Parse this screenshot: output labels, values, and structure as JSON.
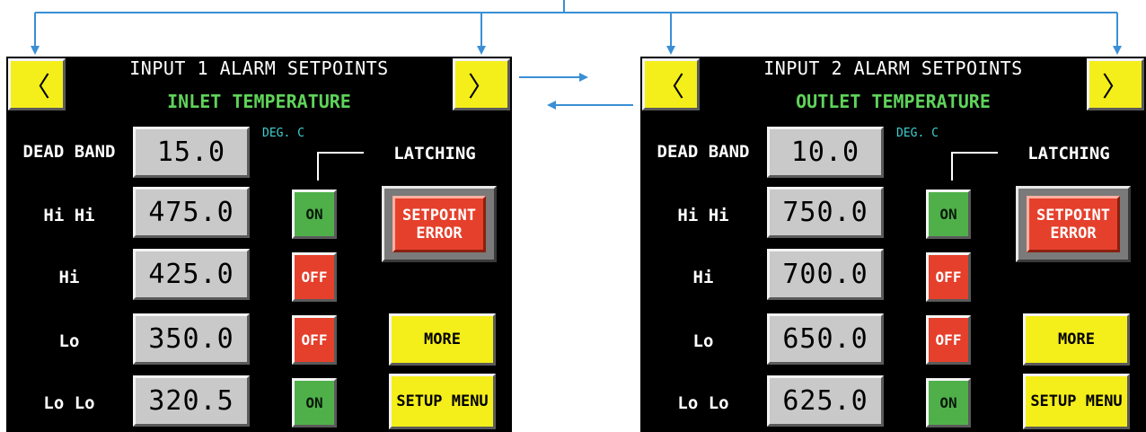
{
  "connector_color": "#3a8fd6",
  "screens": [
    {
      "title": "INPUT 1 ALARM SETPOINTS",
      "subtitle": "INLET TEMPERATURE",
      "prev_label": "〈",
      "next_label": "〉",
      "unit": "DEG. C",
      "latching_label": "LATCHING",
      "error_label": "SETPOINT ERROR",
      "more_label": "MORE",
      "setup_label": "SETUP MENU",
      "deadband": {
        "label": "DEAD BAND",
        "value": "15.0"
      },
      "rows": [
        {
          "label": "Hi Hi",
          "value": "475.0",
          "latch": "ON"
        },
        {
          "label": "Hi",
          "value": "425.0",
          "latch": "OFF"
        },
        {
          "label": "Lo",
          "value": "350.0",
          "latch": "OFF"
        },
        {
          "label": "Lo Lo",
          "value": "320.5",
          "latch": "ON"
        }
      ]
    },
    {
      "title": "INPUT 2 ALARM SETPOINTS",
      "subtitle": "OUTLET TEMPERATURE",
      "prev_label": "〈",
      "next_label": "〉",
      "unit": "DEG. C",
      "latching_label": "LATCHING",
      "error_label": "SETPOINT ERROR",
      "more_label": "MORE",
      "setup_label": "SETUP MENU",
      "deadband": {
        "label": "DEAD BAND",
        "value": "10.0"
      },
      "rows": [
        {
          "label": "Hi Hi",
          "value": "750.0",
          "latch": "ON"
        },
        {
          "label": "Hi",
          "value": "700.0",
          "latch": "OFF"
        },
        {
          "label": "Lo",
          "value": "650.0",
          "latch": "OFF"
        },
        {
          "label": "Lo Lo",
          "value": "625.0",
          "latch": "ON"
        }
      ]
    }
  ]
}
